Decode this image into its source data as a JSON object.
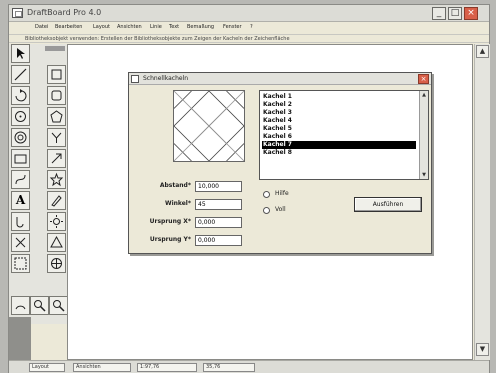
{
  "window": {
    "title": "DraftBoard Pro 4.0",
    "buttons": {
      "minimize": "_",
      "maximize": "□",
      "close": "×"
    }
  },
  "menu": [
    "Datei",
    "Bearbeiten",
    "Layout",
    "Ansichten",
    "Linie",
    "Text",
    "Bemaßung",
    "Fenster",
    "?"
  ],
  "statusline": "Bibliotheksobjekt verwenden: Erstellen der Bibliotheksobjekte zum Zeigen der Kacheln der Zeichenfläche",
  "dialog": {
    "title": "Schnellkacheln",
    "close": "×",
    "fields": [
      {
        "label": "Abstand*",
        "value": "10,000"
      },
      {
        "label": "Winkel*",
        "value": "45"
      },
      {
        "label": "Ursprung X*",
        "value": "0,000"
      },
      {
        "label": "Ursprung Y*",
        "value": "0,000"
      }
    ],
    "list": [
      "Kachel 1",
      "Kachel 2",
      "Kachel 3",
      "Kachel 4",
      "Kachel 5",
      "Kachel 6",
      "Kachel 7",
      "Kachel 8"
    ],
    "selected_index": 6,
    "options": [
      "Hilfe",
      "Voll"
    ],
    "run_button": "Ausführen"
  },
  "bottombar": [
    "Layout",
    "Ansichten",
    "1:97,76",
    "35,76"
  ],
  "icons": [
    "arrow-icon",
    "line-icon",
    "rotate-icon",
    "circle-icon",
    "target-icon",
    "square-icon",
    "curve-icon",
    "text-icon",
    "pen-icon",
    "cross-icon",
    "triangle-icon",
    "select-icon",
    "zoom-icon",
    "hand-icon"
  ]
}
